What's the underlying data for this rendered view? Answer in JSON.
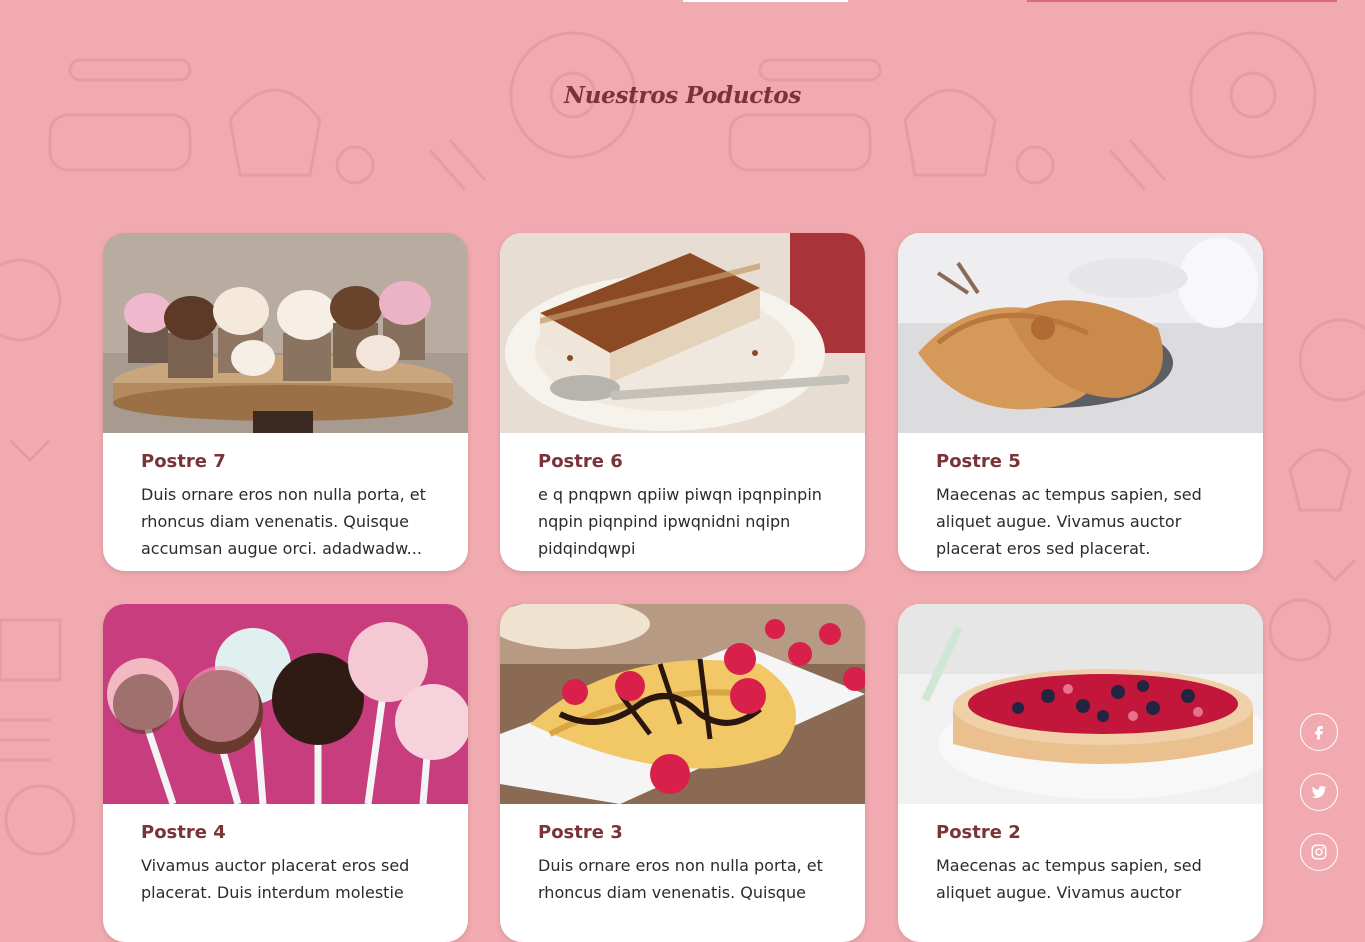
{
  "section": {
    "title": "Nuestros Poductos"
  },
  "products": [
    {
      "name": "Postre 7",
      "description": "Duis ornare eros non nulla porta, et rhoncus diam venenatis. Quisque accumsan augue orci. adadwadw... dwadawdwadwadw"
    },
    {
      "name": "Postre 6",
      "description": "e q pnqpwn qpiiw piwqn ipqnpinpin nqpin piqnpind ipwqnidni nqipn pidqindqwpi"
    },
    {
      "name": "Postre 5",
      "description": "Maecenas ac tempus sapien, sed aliquet augue. Vivamus auctor placerat eros sed placerat."
    },
    {
      "name": "Postre 4",
      "description": "Vivamus auctor placerat eros sed placerat. Duis interdum molestie"
    },
    {
      "name": "Postre 3",
      "description": "Duis ornare eros non nulla porta, et rhoncus diam venenatis. Quisque"
    },
    {
      "name": "Postre 2",
      "description": "Maecenas ac tempus sapien, sed aliquet augue. Vivamus auctor"
    }
  ],
  "social": [
    {
      "icon": "facebook-icon"
    },
    {
      "icon": "twitter-icon"
    },
    {
      "icon": "instagram-icon"
    }
  ],
  "colors": {
    "background": "#f1abb0",
    "accent": "#7a3338",
    "card": "#ffffff"
  }
}
